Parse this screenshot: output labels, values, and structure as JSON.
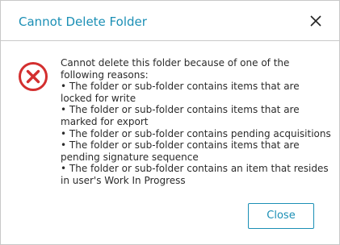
{
  "dialog": {
    "title": "Cannot Delete Folder",
    "close_icon": "close-icon",
    "error_icon": "error-circle-x-icon",
    "message_intro": "Cannot delete this folder because of one of the following reasons:",
    "reasons": [
      "• The folder or sub-folder contains items that are locked for write",
      "• The folder or sub-folder contains items that are marked for export",
      "• The folder or sub-folder contains pending acquisitions",
      "• The folder or sub-folder contains items that are pending signature sequence",
      "• The folder or sub-folder contains an item that resides in user's Work In Progress"
    ],
    "close_button_label": "Close"
  },
  "colors": {
    "accent": "#1b8fb5",
    "error_red": "#d32f2f",
    "border": "#c8c8c8"
  }
}
